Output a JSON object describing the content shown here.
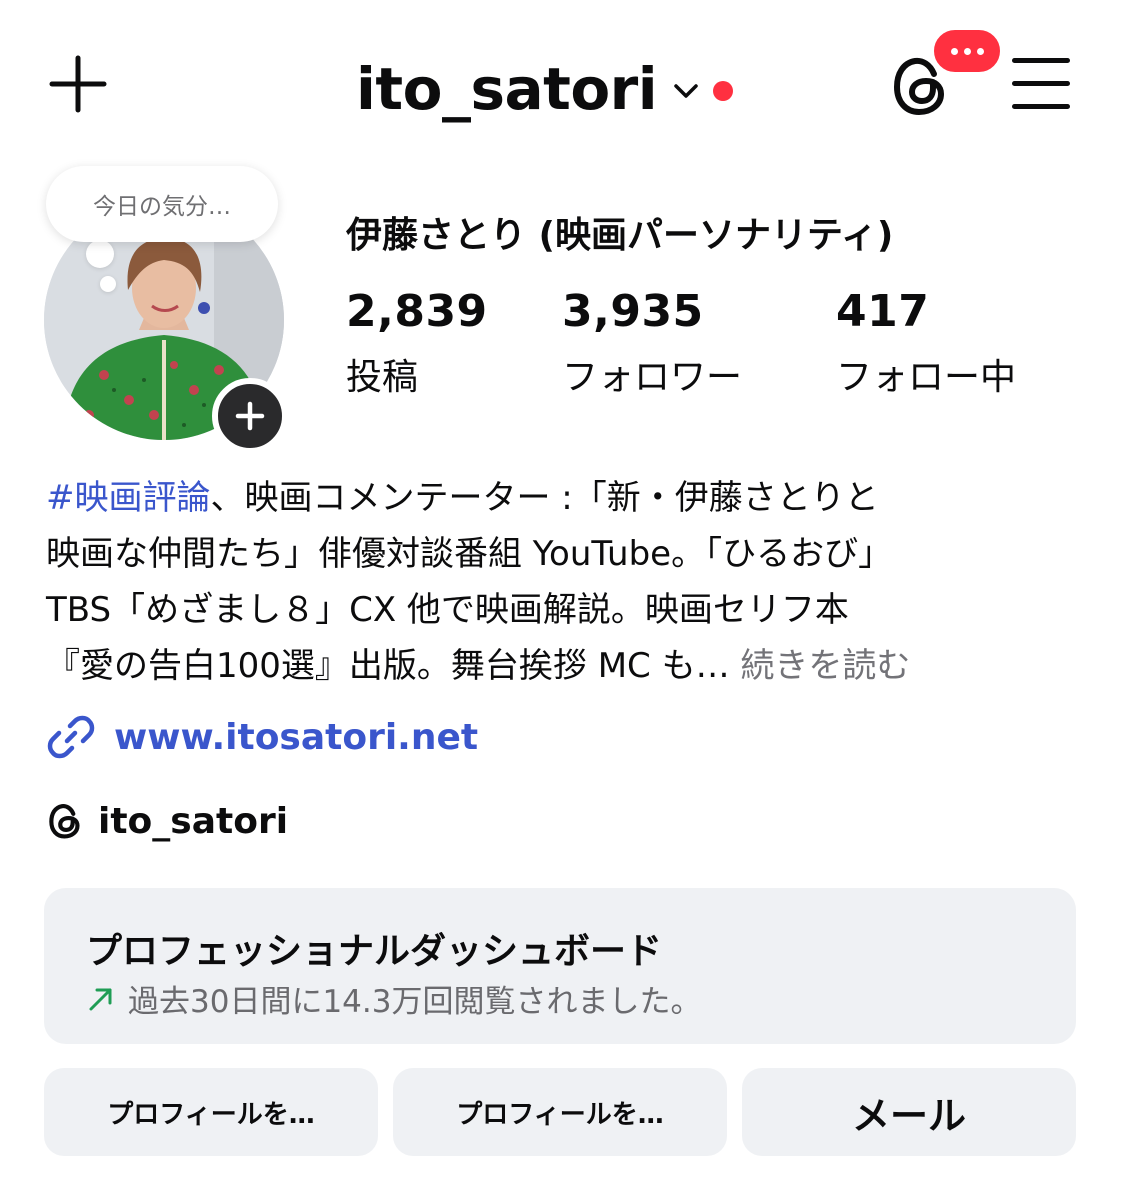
{
  "header": {
    "username": "ito_satori",
    "icons": [
      "plus-icon",
      "chevron-down-icon",
      "threads-icon",
      "hamburger-menu-icon"
    ],
    "accent_color": "#ff3040"
  },
  "profile": {
    "note": "今日の気分…",
    "display_name": "伊藤さとり (映画パーソナリティ)",
    "stats": [
      {
        "value": "2,839",
        "label": "投稿"
      },
      {
        "value": "3,935",
        "label": "フォロワー"
      },
      {
        "value": "417",
        "label": "フォロー中"
      }
    ]
  },
  "bio": {
    "hashtag": "#映画評論",
    "line1_rest": "、映画コメンテーター :「新・伊藤さとりと",
    "line2": "映画な仲間たち」俳優対談番組 YouTube。「ひるおび」",
    "line3": "TBS「めざまし８」CX 他で映画解説。映画セリフ本",
    "line4": "『愛の告白100選』出版。舞台挨拶 MC も…",
    "more_label": "続きを読む"
  },
  "link": {
    "text": "www.itosatori.net",
    "color": "#3a56cc"
  },
  "threads": {
    "handle": "ito_satori"
  },
  "dashboard": {
    "title": "プロフェッショナルダッシュボード",
    "subtitle": "過去30日間に14.3万回閲覧されました。",
    "trend_color": "#1f9d55"
  },
  "buttons": {
    "edit_profile": "プロフィールを…",
    "share_profile": "プロフィールを…",
    "mail": "メール"
  }
}
